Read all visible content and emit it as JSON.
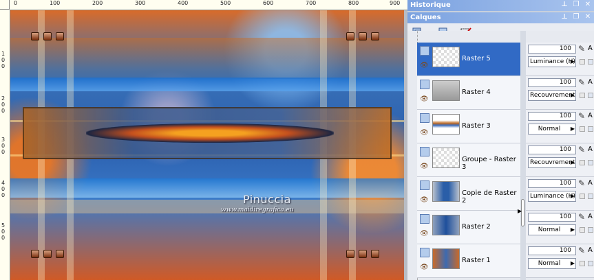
{
  "rulers": {
    "top_labels": [
      "0",
      "100",
      "200",
      "300",
      "400",
      "500",
      "600",
      "700",
      "800",
      "900"
    ],
    "left_labels": [
      "1\n0\n0",
      "2\n0\n0",
      "3\n0\n0",
      "4\n0\n0",
      "5\n0\n0"
    ]
  },
  "canvas": {
    "watermark": "Pinuccia",
    "watermark_url": "www.maidiregrafica.eu"
  },
  "history_panel": {
    "title": "Historique"
  },
  "layers_panel": {
    "title": "Calques",
    "toolbar": {
      "new_layer_icon": "new-layer-icon",
      "delete_icon": "delete-layer-icon",
      "edit_icon": "edit-selection-icon"
    },
    "layers": [
      {
        "name": "Raster 5",
        "opacity": "100",
        "blend": "Luminance (H)",
        "selected": true
      },
      {
        "name": "Raster 4",
        "opacity": "100",
        "blend": "Recouvrement",
        "selected": false
      },
      {
        "name": "Raster 3",
        "opacity": "100",
        "blend": "Normal",
        "selected": false
      },
      {
        "name": "Groupe - Raster 3",
        "opacity": "100",
        "blend": "Recouvrement",
        "selected": false
      },
      {
        "name": "Copie de Raster 2",
        "opacity": "100",
        "blend": "Luminance (H)",
        "selected": false
      },
      {
        "name": "Raster 2",
        "opacity": "100",
        "blend": "Normal",
        "selected": false
      },
      {
        "name": "Raster 1",
        "opacity": "100",
        "blend": "Normal",
        "selected": false
      }
    ],
    "props_letter": "A"
  },
  "colors": {
    "selection": "#316ac5",
    "titlebar": "#7ba2e0"
  }
}
